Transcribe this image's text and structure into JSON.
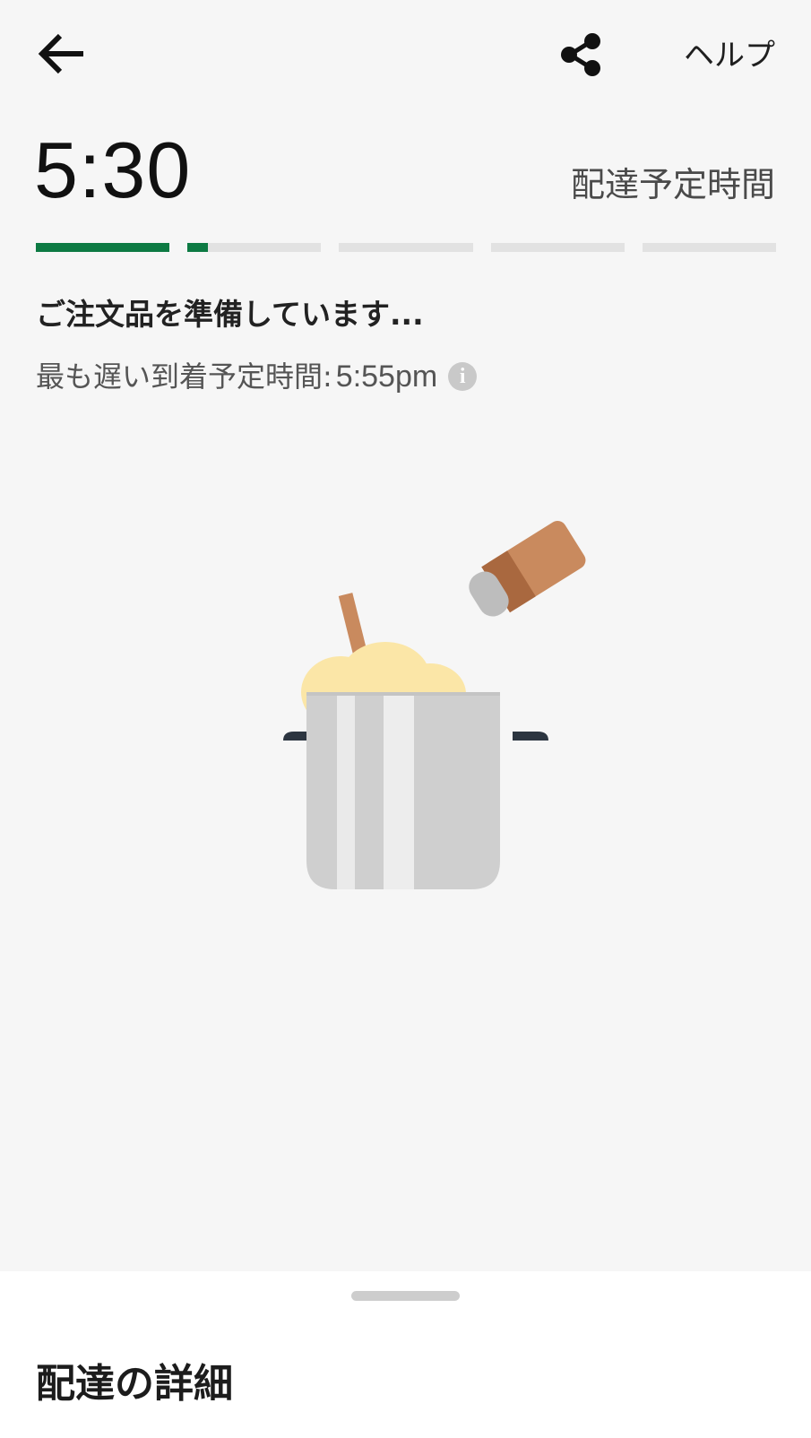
{
  "header": {
    "back_icon": "arrow-left-icon",
    "share_icon": "share-icon",
    "help_label": "ヘルプ"
  },
  "eta": {
    "time": "5:30",
    "label": "配達予定時間"
  },
  "progress": {
    "segments": [
      1.0,
      0.15,
      0,
      0,
      0
    ],
    "accent_color": "#0d7a43",
    "track_color": "#e2e2e2"
  },
  "status": {
    "message": "ご注文品を準備しています...",
    "latest_label": "最も遅い到着予定時間:",
    "latest_time": "5:55pm",
    "info_icon": "info-icon"
  },
  "illustration": {
    "icon": "cooking-pot-illustration"
  },
  "sheet": {
    "title": "配達の詳細"
  }
}
